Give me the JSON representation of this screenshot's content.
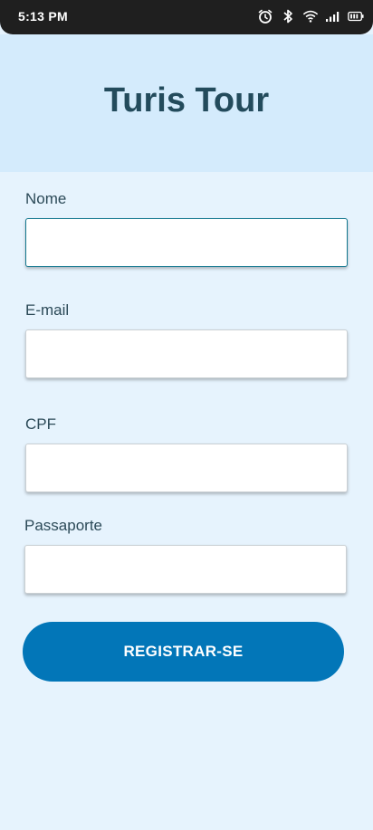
{
  "status_bar": {
    "time": "5:13 PM",
    "icons": [
      "alarm-icon",
      "bluetooth-icon",
      "wifi-icon",
      "signal-icon",
      "battery-icon"
    ]
  },
  "header": {
    "title": "Turis Tour"
  },
  "form": {
    "fields": [
      {
        "label": "Nome",
        "value": ""
      },
      {
        "label": "E-mail",
        "value": ""
      },
      {
        "label": "CPF",
        "value": ""
      },
      {
        "label": "Passaporte",
        "value": ""
      }
    ],
    "submit_label": "REGISTRAR-SE"
  },
  "colors": {
    "background": "#e6f3fd",
    "header_background": "#d4ebfc",
    "title": "#234b5c",
    "button": "#0276b8",
    "focus_border": "#13778f"
  }
}
